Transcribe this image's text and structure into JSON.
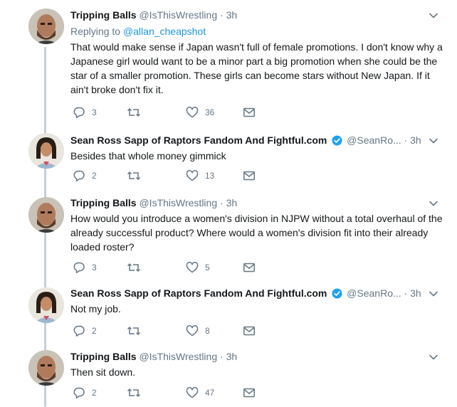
{
  "tweets": [
    {
      "avatar": "bearded-man-avatar",
      "name": "Tripping Balls",
      "handle": "@IsThisWrestling",
      "dot": "·",
      "time": "3h",
      "replying_prefix": "Replying to",
      "replying_to": "@allan_cheapshot",
      "text": "That would make sense if Japan wasn't full of female promotions. I don't know why a Japanese girl would want to be a minor part a big promotion when she could be the star of a smaller promotion. These girls can become stars without New Japan. If it ain't broke don't fix it.",
      "replies": "3",
      "retweets": "",
      "likes": "36"
    },
    {
      "avatar": "long-hair-man-avatar",
      "name": "Sean Ross Sapp of Raptors Fandom And Fightful.com",
      "handle": "@SeanRo...",
      "dot": "·",
      "time": "3h",
      "verified": true,
      "text": "Besides that whole money gimmick",
      "replies": "2",
      "retweets": "",
      "likes": "13"
    },
    {
      "avatar": "bearded-man-avatar",
      "name": "Tripping Balls",
      "handle": "@IsThisWrestling",
      "dot": "·",
      "time": "3h",
      "text": "How would you introduce a women's division in NJPW without a total overhaul of the already successful product? Where would a women's division fit into their already loaded roster?",
      "replies": "3",
      "retweets": "",
      "likes": "5"
    },
    {
      "avatar": "long-hair-man-avatar",
      "name": "Sean Ross Sapp of Raptors Fandom And Fightful.com",
      "handle": "@SeanRo...",
      "dot": "·",
      "time": "3h",
      "verified": true,
      "text": "Not my job.",
      "replies": "2",
      "retweets": "",
      "likes": "8"
    },
    {
      "avatar": "bearded-man-avatar",
      "name": "Tripping Balls",
      "handle": "@IsThisWrestling",
      "dot": "·",
      "time": "3h",
      "text": "Then sit down.",
      "replies": "2",
      "retweets": "",
      "likes": "47"
    }
  ],
  "icons": {
    "reply": "reply-icon",
    "retweet": "retweet-icon",
    "like": "heart-icon",
    "dm": "envelope-icon",
    "more": "chevron-down-icon",
    "verified": "verified-badge-icon"
  },
  "colors": {
    "text": "#14171a",
    "muted": "#657786",
    "link": "#1b95e0",
    "verified": "#1da1f2",
    "thread": "#c4cfd6"
  }
}
